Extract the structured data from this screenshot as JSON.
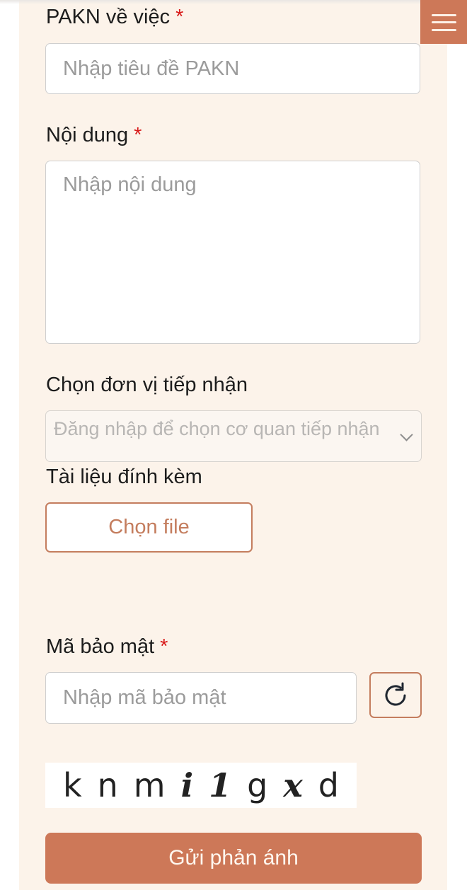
{
  "header": {
    "menu_icon": "hamburger-menu-icon"
  },
  "form": {
    "subject": {
      "label": "PAKN về việc",
      "required_mark": "*",
      "placeholder": "Nhập tiêu đề PAKN",
      "value": ""
    },
    "content": {
      "label": "Nội dung",
      "required_mark": "*",
      "placeholder": "Nhập nội dung",
      "value": ""
    },
    "receiver": {
      "label": "Chọn đơn vị tiếp nhận",
      "placeholder": "Đăng nhập để chọn cơ quan tiếp nhận",
      "icon": "chevron-down-icon"
    },
    "attachment": {
      "label": "Tài liệu đính kèm",
      "button_label": "Chọn file"
    },
    "security_code": {
      "label": "Mã bảo mật",
      "required_mark": "*",
      "placeholder": "Nhập mã bảo mật",
      "value": "",
      "refresh_icon": "refresh-icon"
    },
    "captcha": {
      "chars": [
        {
          "c": "k",
          "italic": false
        },
        {
          "c": "n",
          "italic": false
        },
        {
          "c": "m",
          "italic": false
        },
        {
          "c": "i",
          "italic": true
        },
        {
          "c": "1",
          "italic": true
        },
        {
          "c": "g",
          "italic": false
        },
        {
          "c": "x",
          "italic": true
        },
        {
          "c": "d",
          "italic": false
        }
      ]
    },
    "submit_label": "Gửi phản ánh"
  },
  "colors": {
    "accent": "#cd7858",
    "panel_bg": "#fcf3ea",
    "required": "#d81b1b"
  }
}
